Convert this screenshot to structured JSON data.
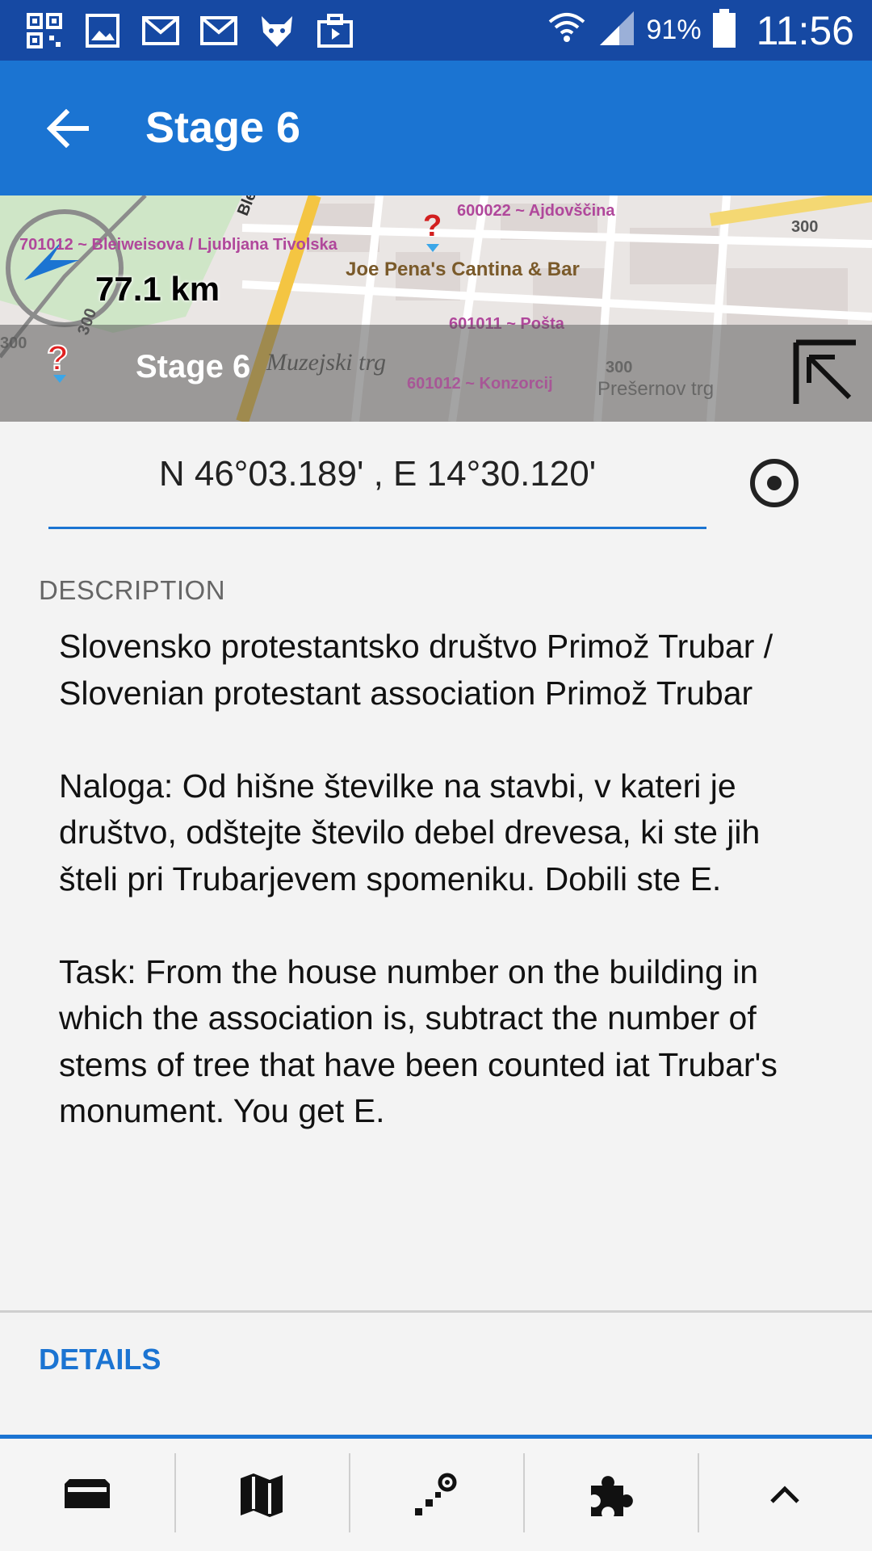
{
  "status_bar": {
    "battery_pct": "91%",
    "time": "11:56",
    "left_icons": [
      "qr-code-icon",
      "gallery-icon",
      "gmail-icon",
      "gmail-icon",
      "fox-app-icon",
      "briefcase-play-icon"
    ]
  },
  "app_bar": {
    "title": "Stage 6",
    "back_icon": "arrow-left-icon"
  },
  "map": {
    "labels": {
      "bleiweisova": "701012 ~ Bleiweisova / Ljubljana Tivolska",
      "ajdovscina": "600022 ~ Ajdovščina",
      "cantina": "Joe Pena's Cantina & Bar",
      "posta": "601011 ~ Pošta",
      "konzorcij": "601012 ~ Konzorcij",
      "muzejski": "Muzejski trg",
      "presernov": "Prešernov trg",
      "bleiweis_road": "Bleiweiso",
      "road_300_a": "300",
      "road_300_b": "300",
      "road_300_c": "300",
      "road_300_d": "300"
    },
    "distance": "77.1 km",
    "overlay_title": "Stage 6"
  },
  "coordinates": {
    "value": "N 46°03.189' , E 14°30.120'"
  },
  "description": {
    "label": "DESCRIPTION",
    "text": "Slovensko protestantsko društvo Primož Trubar / Slovenian protestant association Primož Trubar\n\nNaloga: Od hišne številke na stavbi, v kateri je društvo, odštejte število debel drevesa, ki ste jih šteli pri Trubarjevem spomeniku. Dobili ste E.\n\nTask: From the house number on the building in which the association is, subtract the number of stems of tree that have been counted iat Trubar's monument. You get E."
  },
  "details_label": "DETAILS",
  "bottom_bar": {
    "items": [
      "inbox-tray-icon",
      "map-icon",
      "route-points-icon",
      "puzzle-icon",
      "chevron-up-icon"
    ]
  },
  "colors": {
    "status_bar": "#1649a3",
    "app_bar": "#1b74d2",
    "accent": "#1b74d2",
    "background": "#f3f3f3"
  }
}
